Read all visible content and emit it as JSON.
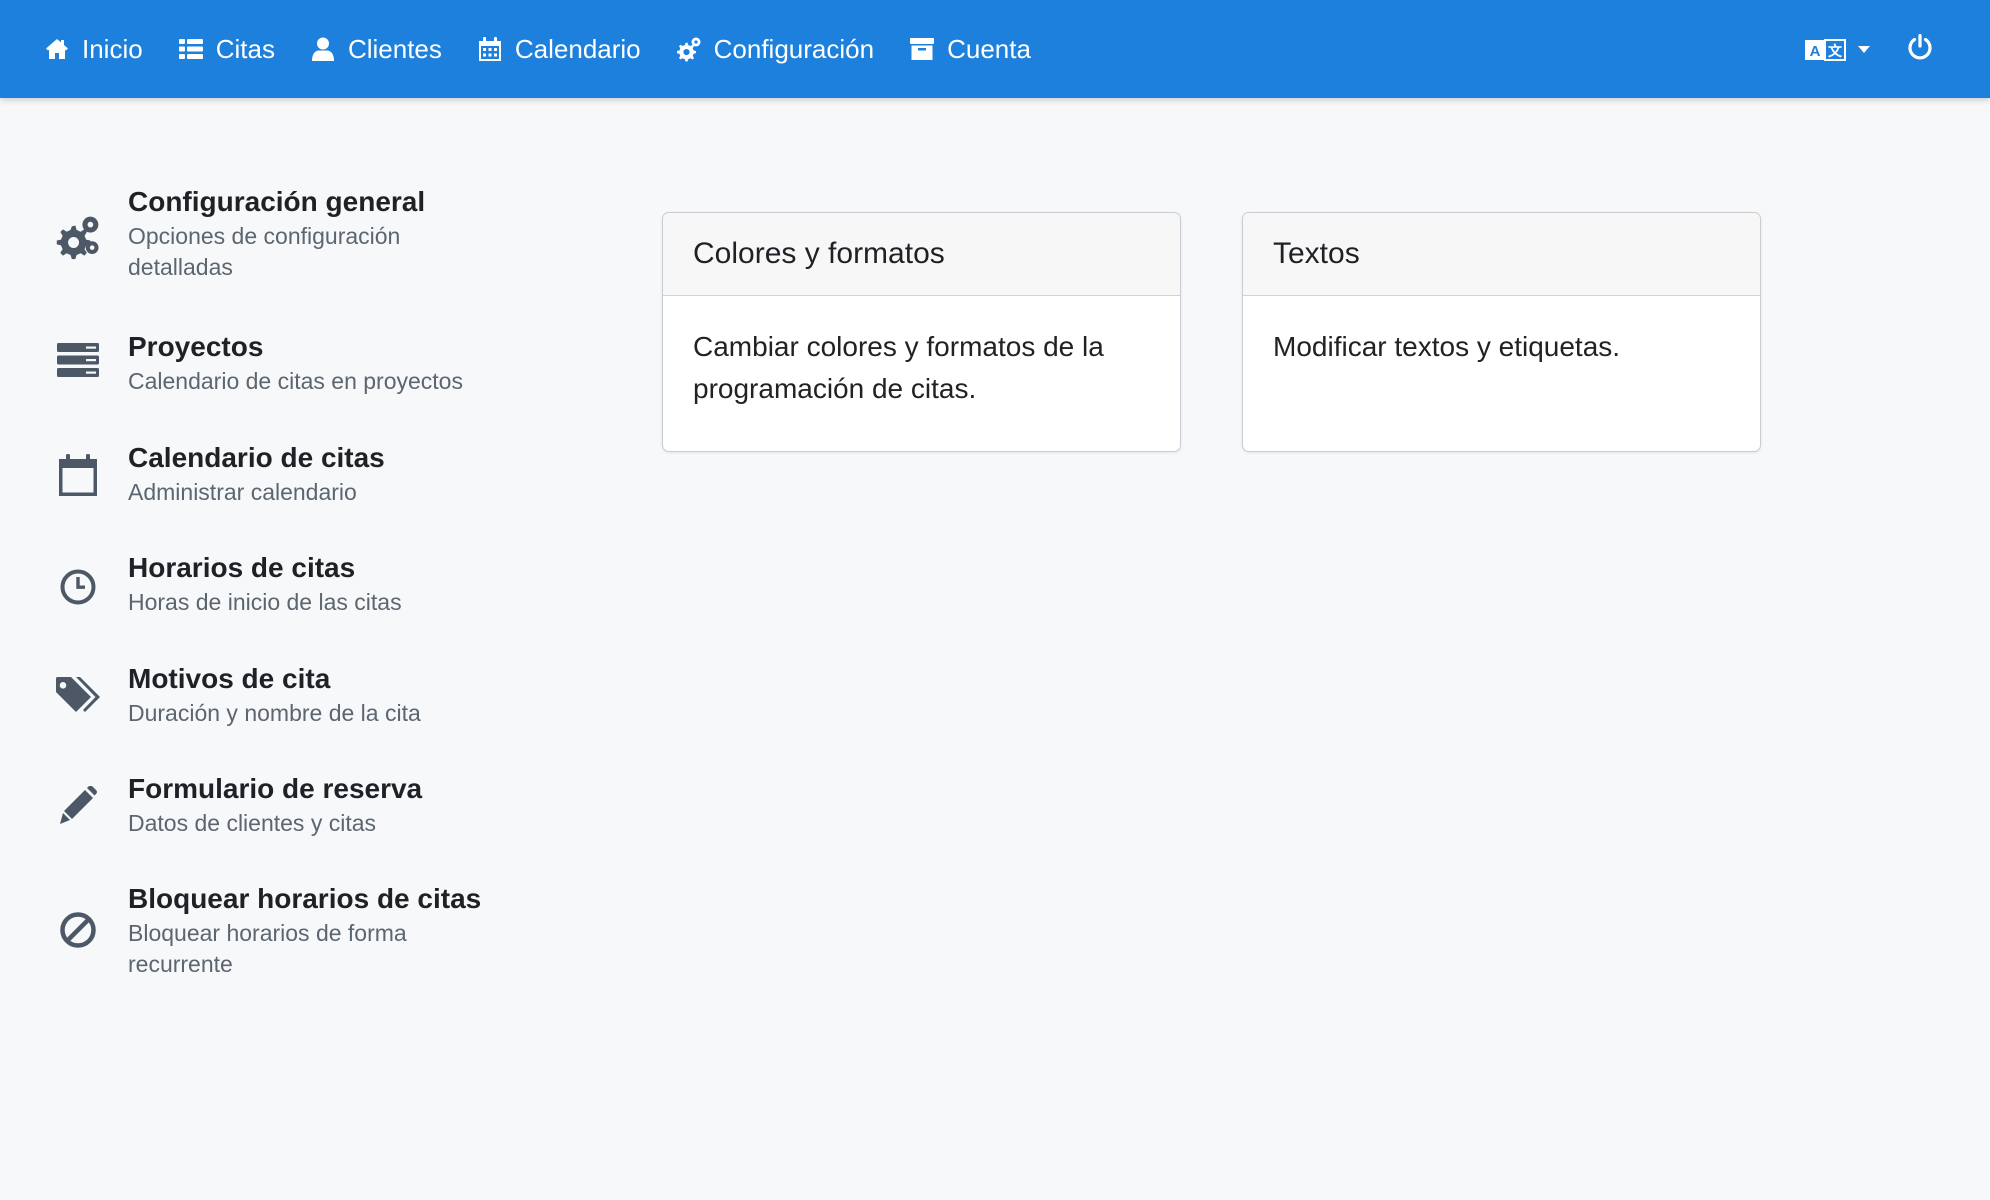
{
  "navbar": {
    "items": [
      {
        "label": "Inicio",
        "icon": "home-icon"
      },
      {
        "label": "Citas",
        "icon": "list-icon"
      },
      {
        "label": "Clientes",
        "icon": "user-icon"
      },
      {
        "label": "Calendario",
        "icon": "calendar-icon"
      },
      {
        "label": "Configuración",
        "icon": "gears-icon"
      },
      {
        "label": "Cuenta",
        "icon": "archive-icon"
      }
    ],
    "right": {
      "language_icon": "language-icon",
      "power_icon": "power-icon"
    },
    "color": "#1c80dc"
  },
  "sidebar": {
    "items": [
      {
        "title": "Configuración general",
        "desc": "Opciones de configuración detalladas",
        "icon": "gears-icon"
      },
      {
        "title": "Proyectos",
        "desc": "Calendario de citas en proyectos",
        "icon": "server-icon"
      },
      {
        "title": "Calendario de citas",
        "desc": "Administrar calendario",
        "icon": "calendar-icon"
      },
      {
        "title": "Horarios de citas",
        "desc": "Horas de inicio de las citas",
        "icon": "clock-icon"
      },
      {
        "title": "Motivos de cita",
        "desc": "Duración y nombre de la cita",
        "icon": "tags-icon"
      },
      {
        "title": "Formulario de reserva",
        "desc": "Datos de clientes y citas",
        "icon": "pencil-icon"
      },
      {
        "title": "Bloquear horarios de citas",
        "desc": "Bloquear horarios de forma recurrente",
        "icon": "ban-icon"
      }
    ]
  },
  "cards": [
    {
      "title": "Colores y formatos",
      "body": "Cambiar colores y formatos de la programación de citas."
    },
    {
      "title": "Textos",
      "body": "Modificar textos y etiquetas."
    }
  ]
}
